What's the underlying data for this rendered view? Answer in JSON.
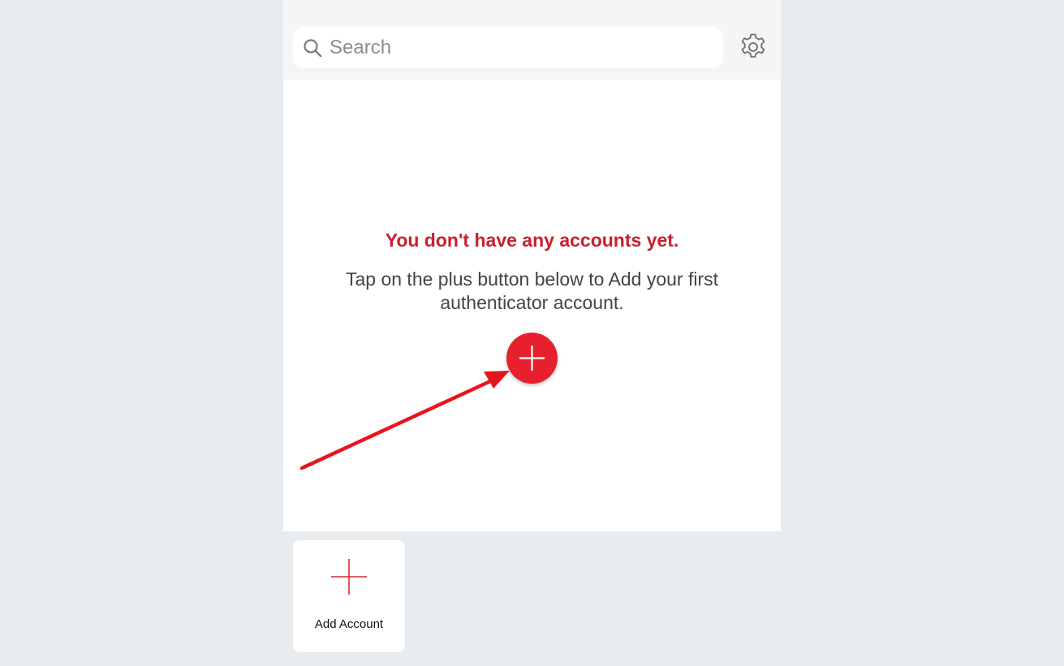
{
  "search": {
    "placeholder": "Search",
    "icon": "search-icon"
  },
  "header": {
    "settings_icon": "gear-icon"
  },
  "empty_state": {
    "title": "You don't have any accounts yet.",
    "description": "Tap on the plus button below to Add your first authenticator account.",
    "add_icon": "plus-icon"
  },
  "toolbar": {
    "add_account_label": "Add Account",
    "add_account_icon": "plus-icon"
  },
  "colors": {
    "accent": "#e8202d",
    "title": "#c8202d",
    "background": "#e8ecee",
    "topbar": "#f5f5f5"
  }
}
